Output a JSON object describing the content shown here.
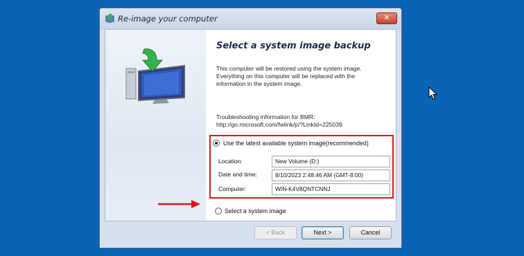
{
  "window": {
    "title": "Re-image your computer",
    "close_glyph": "✕"
  },
  "page": {
    "heading": "Select a system image backup",
    "intro": "This computer will be restored using the system image.\nEverything on this computer will be replaced with the\ninformation in the system image.",
    "troubleshooting": "Troubleshooting information for BMR:\nhttp://go.microsoft.com/fwlink/p/?LinkId=225039"
  },
  "options": {
    "latest_label": "Use the latest available system image(recommended)",
    "latest_selected": true,
    "select_label": "Select a system image",
    "select_selected": false
  },
  "image_details": {
    "location_label": "Location:",
    "location_value": "New Volume (D:)",
    "datetime_label": "Date and time:",
    "datetime_value": "8/10/2023 2:48:46 AM (GMT-8:00)",
    "computer_label": "Computer:",
    "computer_value": "WIN-K4V8QNTCNNJ"
  },
  "buttons": {
    "back": "< Back",
    "next": "Next >",
    "cancel": "Cancel"
  },
  "icons": {
    "title": "reimage-icon",
    "hero": "computer-restore-icon",
    "annotation": "red-arrow-icon",
    "cursor": "mouse-cursor-icon"
  },
  "colors": {
    "desktop": "#0b63b6",
    "highlight": "#e0141b",
    "close_button": "#c4442e"
  }
}
